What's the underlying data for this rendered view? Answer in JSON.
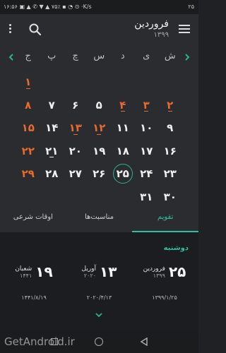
{
  "status": {
    "time": "۱۶:۵۶",
    "indicators": "▣ ▲ ✆ ▼ ▲ ۷۵٪ ▪ ◔ ⊙ ·K/s",
    "right": "۲۵"
  },
  "header": {
    "month": "فروردین",
    "year": "۱۳۹۹"
  },
  "calendar": {
    "weekdays": [
      "ش",
      "ی",
      "د",
      "س",
      "چ",
      "پ",
      "ج"
    ],
    "rows": [
      [
        "",
        "",
        "",
        "",
        "",
        "",
        "۱"
      ],
      [
        "۲",
        "۳",
        "۴",
        "۵",
        "۶",
        "۷",
        "۸"
      ],
      [
        "۹",
        "۱۰",
        "۱۱",
        "۱۲",
        "۱۳",
        "۱۴",
        "۱۵"
      ],
      [
        "۱۶",
        "۱۷",
        "۱۸",
        "۱۹",
        "۲۰",
        "۲۱",
        "۲۲"
      ],
      [
        "۲۳",
        "۲۴",
        "۲۵",
        "۲۶",
        "۲۷",
        "۲۸",
        "۲۹"
      ],
      [
        "۳۰",
        "۳۱",
        "",
        "",
        "",
        "",
        ""
      ]
    ],
    "holidays": [
      "۱",
      "۲",
      "۳",
      "۴",
      "۸",
      "۱۲",
      "۱۳",
      "۱۵",
      "۲۲",
      "۲۹"
    ],
    "event_marks": [
      "۱",
      "۲",
      "۳",
      "۴",
      "۱۲",
      "۱۳",
      "۲۱"
    ],
    "today": "۲۵",
    "holiday_color": "#e86b2b",
    "accent_color": "#29b394"
  },
  "tabs": [
    {
      "label": "تقویم",
      "active": true
    },
    {
      "label": "مناسبت‌ها",
      "active": false
    },
    {
      "label": "اوقات شرعی",
      "active": false
    }
  ],
  "panel": {
    "weekday": "دوشنبه",
    "dates": [
      {
        "num": "۲۵",
        "month": "فروردین",
        "year": "۱۳۹۹",
        "full": "۱۳۹۹/۱/۲۵"
      },
      {
        "num": "۱۳",
        "month": "آوریل",
        "year": "۲۰۲۰",
        "full": "۲۰۲۰/۴/۱۳"
      },
      {
        "num": "۱۹",
        "month": "شعبان",
        "year": "۱۴۴۱",
        "full": "۱۴۴۱/۸/۱۹"
      }
    ]
  },
  "watermark": "GetAndroid.ir"
}
